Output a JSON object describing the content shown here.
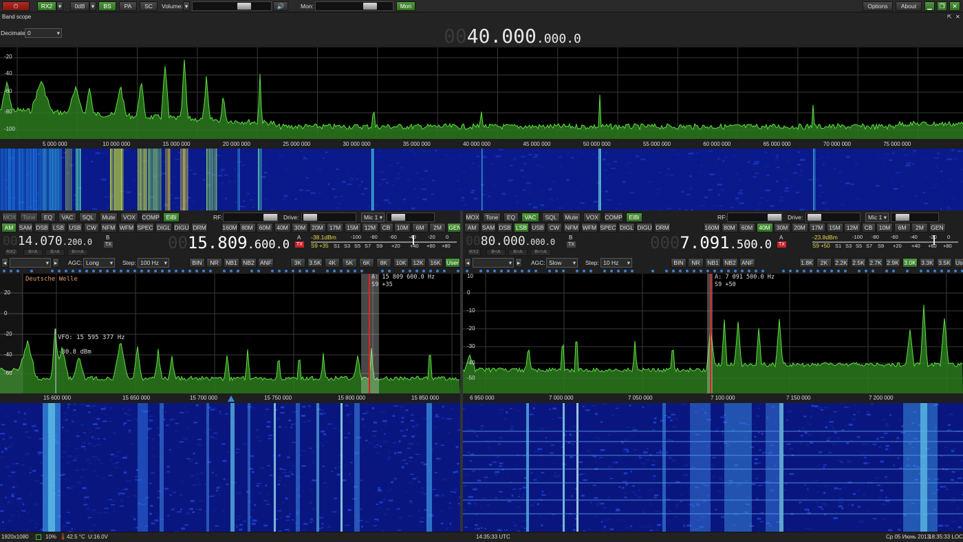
{
  "toolbar": {
    "rx2": "RX2",
    "att": "0dB",
    "bs": "BS",
    "pa": "PA",
    "sc": "SC",
    "volume_label": "Volume:",
    "volume_value": 0.72,
    "mon_label": "Mon:",
    "mon_value": 0.75,
    "mon_btn": "Mon",
    "options": "Options",
    "about": "About"
  },
  "bandscope": {
    "title": "Band scope",
    "decimate_label": "Decimate",
    "decimate_value": "0",
    "freq_dim": "00",
    "freq_main": "40.000",
    "freq_small": ".000.0",
    "ylabels": [
      "-20",
      "-40",
      "-60",
      "-80",
      "-100"
    ],
    "xlabels": [
      "5 000 000",
      "10 000 000",
      "15 000 000",
      "20 000 000",
      "25 000 000",
      "30 000 000",
      "35 000 000",
      "40 000 000",
      "45 000 000",
      "50 000 000",
      "55 000 000",
      "60 000 000",
      "65 000 000",
      "70 000 000",
      "75 000 000"
    ]
  },
  "rx1": {
    "row1": [
      "MOX",
      "Tone",
      "EQ",
      "VAC",
      "SQL",
      "Mute",
      "VOX",
      "COMP",
      "EiBi"
    ],
    "rf_label": "RF:",
    "drive_label": "Drive:",
    "mic": "Mic 1",
    "modes": [
      "AM",
      "SAM",
      "DSB",
      "LSB",
      "USB",
      "CW",
      "NFM",
      "WFM",
      "SPEC",
      "DIGL",
      "DIGU",
      "DRM"
    ],
    "bands": [
      "160M",
      "80M",
      "60M",
      "40M",
      "30M",
      "20M",
      "17M",
      "15M",
      "12M",
      "CB",
      "10M",
      "6M",
      "2M",
      "GEN"
    ],
    "vfob_dim": "00",
    "vfob_main": "14.070",
    "vfob_small": ".200.0",
    "b_tag": "B",
    "tx_tag": "TX",
    "vfoa_dim": "00",
    "vfoa_main": "15.809",
    "vfoa_small": ".600.0",
    "a_tag": "A",
    "tx_tag_red": "TX",
    "dbm": "-38.1dBm",
    "meter_top": [
      "-100",
      "-80",
      "-60",
      "-40",
      "-20",
      "0"
    ],
    "s_reading": "S9 +35",
    "meter_bottom": [
      "S1",
      "S3",
      "S5",
      "S7",
      "S9",
      "+20",
      "+40",
      "+60",
      "+80"
    ],
    "swap": [
      "RX2",
      "B<A",
      "B>A",
      "B<>A"
    ],
    "agc_label": "AGC:",
    "agc_value": "Long",
    "step_label": "Step:",
    "step_value": "100 Hz",
    "dsp": [
      "BIN",
      "NR",
      "NB1",
      "NB2",
      "ANF"
    ],
    "filters": [
      "3K",
      "3.5K",
      "4K",
      "5K",
      "6K",
      "8K",
      "10K",
      "12K",
      "16K",
      "User"
    ],
    "station": "Deutsche Welle",
    "cursor_info1": "A: 15 809 600.0 Hz",
    "cursor_info2": "S9 +35",
    "vfo_info1": "VFO: 15 595 377 Hz",
    "vfo_info2": "-30.8 dBm",
    "ylabels": [
      "20",
      "0",
      "-20",
      "-40",
      "-60"
    ],
    "xlabels": [
      "15 600 000",
      "15 650 000",
      "15 700 000",
      "15 750 000",
      "15 800 000",
      "15 850 000"
    ]
  },
  "rx2": {
    "row1": [
      "MOX",
      "Tone",
      "EQ",
      "VAC",
      "SQL",
      "Mute",
      "VOX",
      "COMP",
      "EiBi"
    ],
    "rf_label": "RF:",
    "drive_label": "Drive:",
    "mic": "Mic 1",
    "modes": [
      "AM",
      "SAM",
      "DSB",
      "LSB",
      "USB",
      "CW",
      "NFM",
      "WFM",
      "SPEC",
      "DIGL",
      "DIGU",
      "DRM"
    ],
    "bands": [
      "160M",
      "80M",
      "60M",
      "40M",
      "30M",
      "20M",
      "17M",
      "15M",
      "12M",
      "CB",
      "10M",
      "6M",
      "2M",
      "GEN"
    ],
    "vfob_dim": "00",
    "vfob_main": "80.000",
    "vfob_small": ".000.0",
    "b_tag": "B",
    "tx_tag": "TX",
    "vfoa_dim": "000",
    "vfoa_main": "7.091",
    "vfoa_small": ".500.0",
    "a_tag": "A",
    "tx_tag_red": "TX",
    "dbm": "-23.8dBm",
    "meter_top": [
      "-100",
      "-80",
      "-60",
      "-40",
      "-20",
      "0"
    ],
    "s_reading": "S9 +50",
    "meter_bottom": [
      "S1",
      "S3",
      "S5",
      "S7",
      "S9",
      "+20",
      "+40",
      "+60",
      "+80"
    ],
    "swap": [
      "RX2",
      "B<A",
      "B>A",
      "B<>A"
    ],
    "agc_label": "AGC:",
    "agc_value": "Slow",
    "step_label": "Step:",
    "step_value": "10 Hz",
    "dsp": [
      "BIN",
      "NR",
      "NB1",
      "NB2",
      "ANF"
    ],
    "filters": [
      "1.8K",
      "2K",
      "2.2K",
      "2.5K",
      "2.7K",
      "2.9K",
      "3.0K",
      "3.3K",
      "3.5K",
      "User"
    ],
    "cursor_info1": "A: 7 091 500.0 Hz",
    "cursor_info2": "S9 +50",
    "ylabels": [
      "10",
      "0",
      "-10",
      "-20",
      "-30",
      "-40",
      "-50"
    ],
    "xlabels": [
      "6 950 000",
      "7 000 000",
      "7 050 000",
      "7 100 000",
      "7 150 000",
      "7 200 000"
    ]
  },
  "status": {
    "resolution": "1920x1080",
    "cpu": "10%",
    "temp": "42.5 °C",
    "voltage": "U:16.0V",
    "utc": "14:35:33 UTC",
    "date": "Ср 05 Июнь 2013",
    "local": "18:35:33 LOC"
  },
  "colors": {
    "spectrum_fill": "#2b7a1e",
    "spectrum_line": "#5fe040",
    "accent_green": "#3d8a2e",
    "tx_red": "#c8202a",
    "waterfall_bg": "#0a1a8a"
  }
}
